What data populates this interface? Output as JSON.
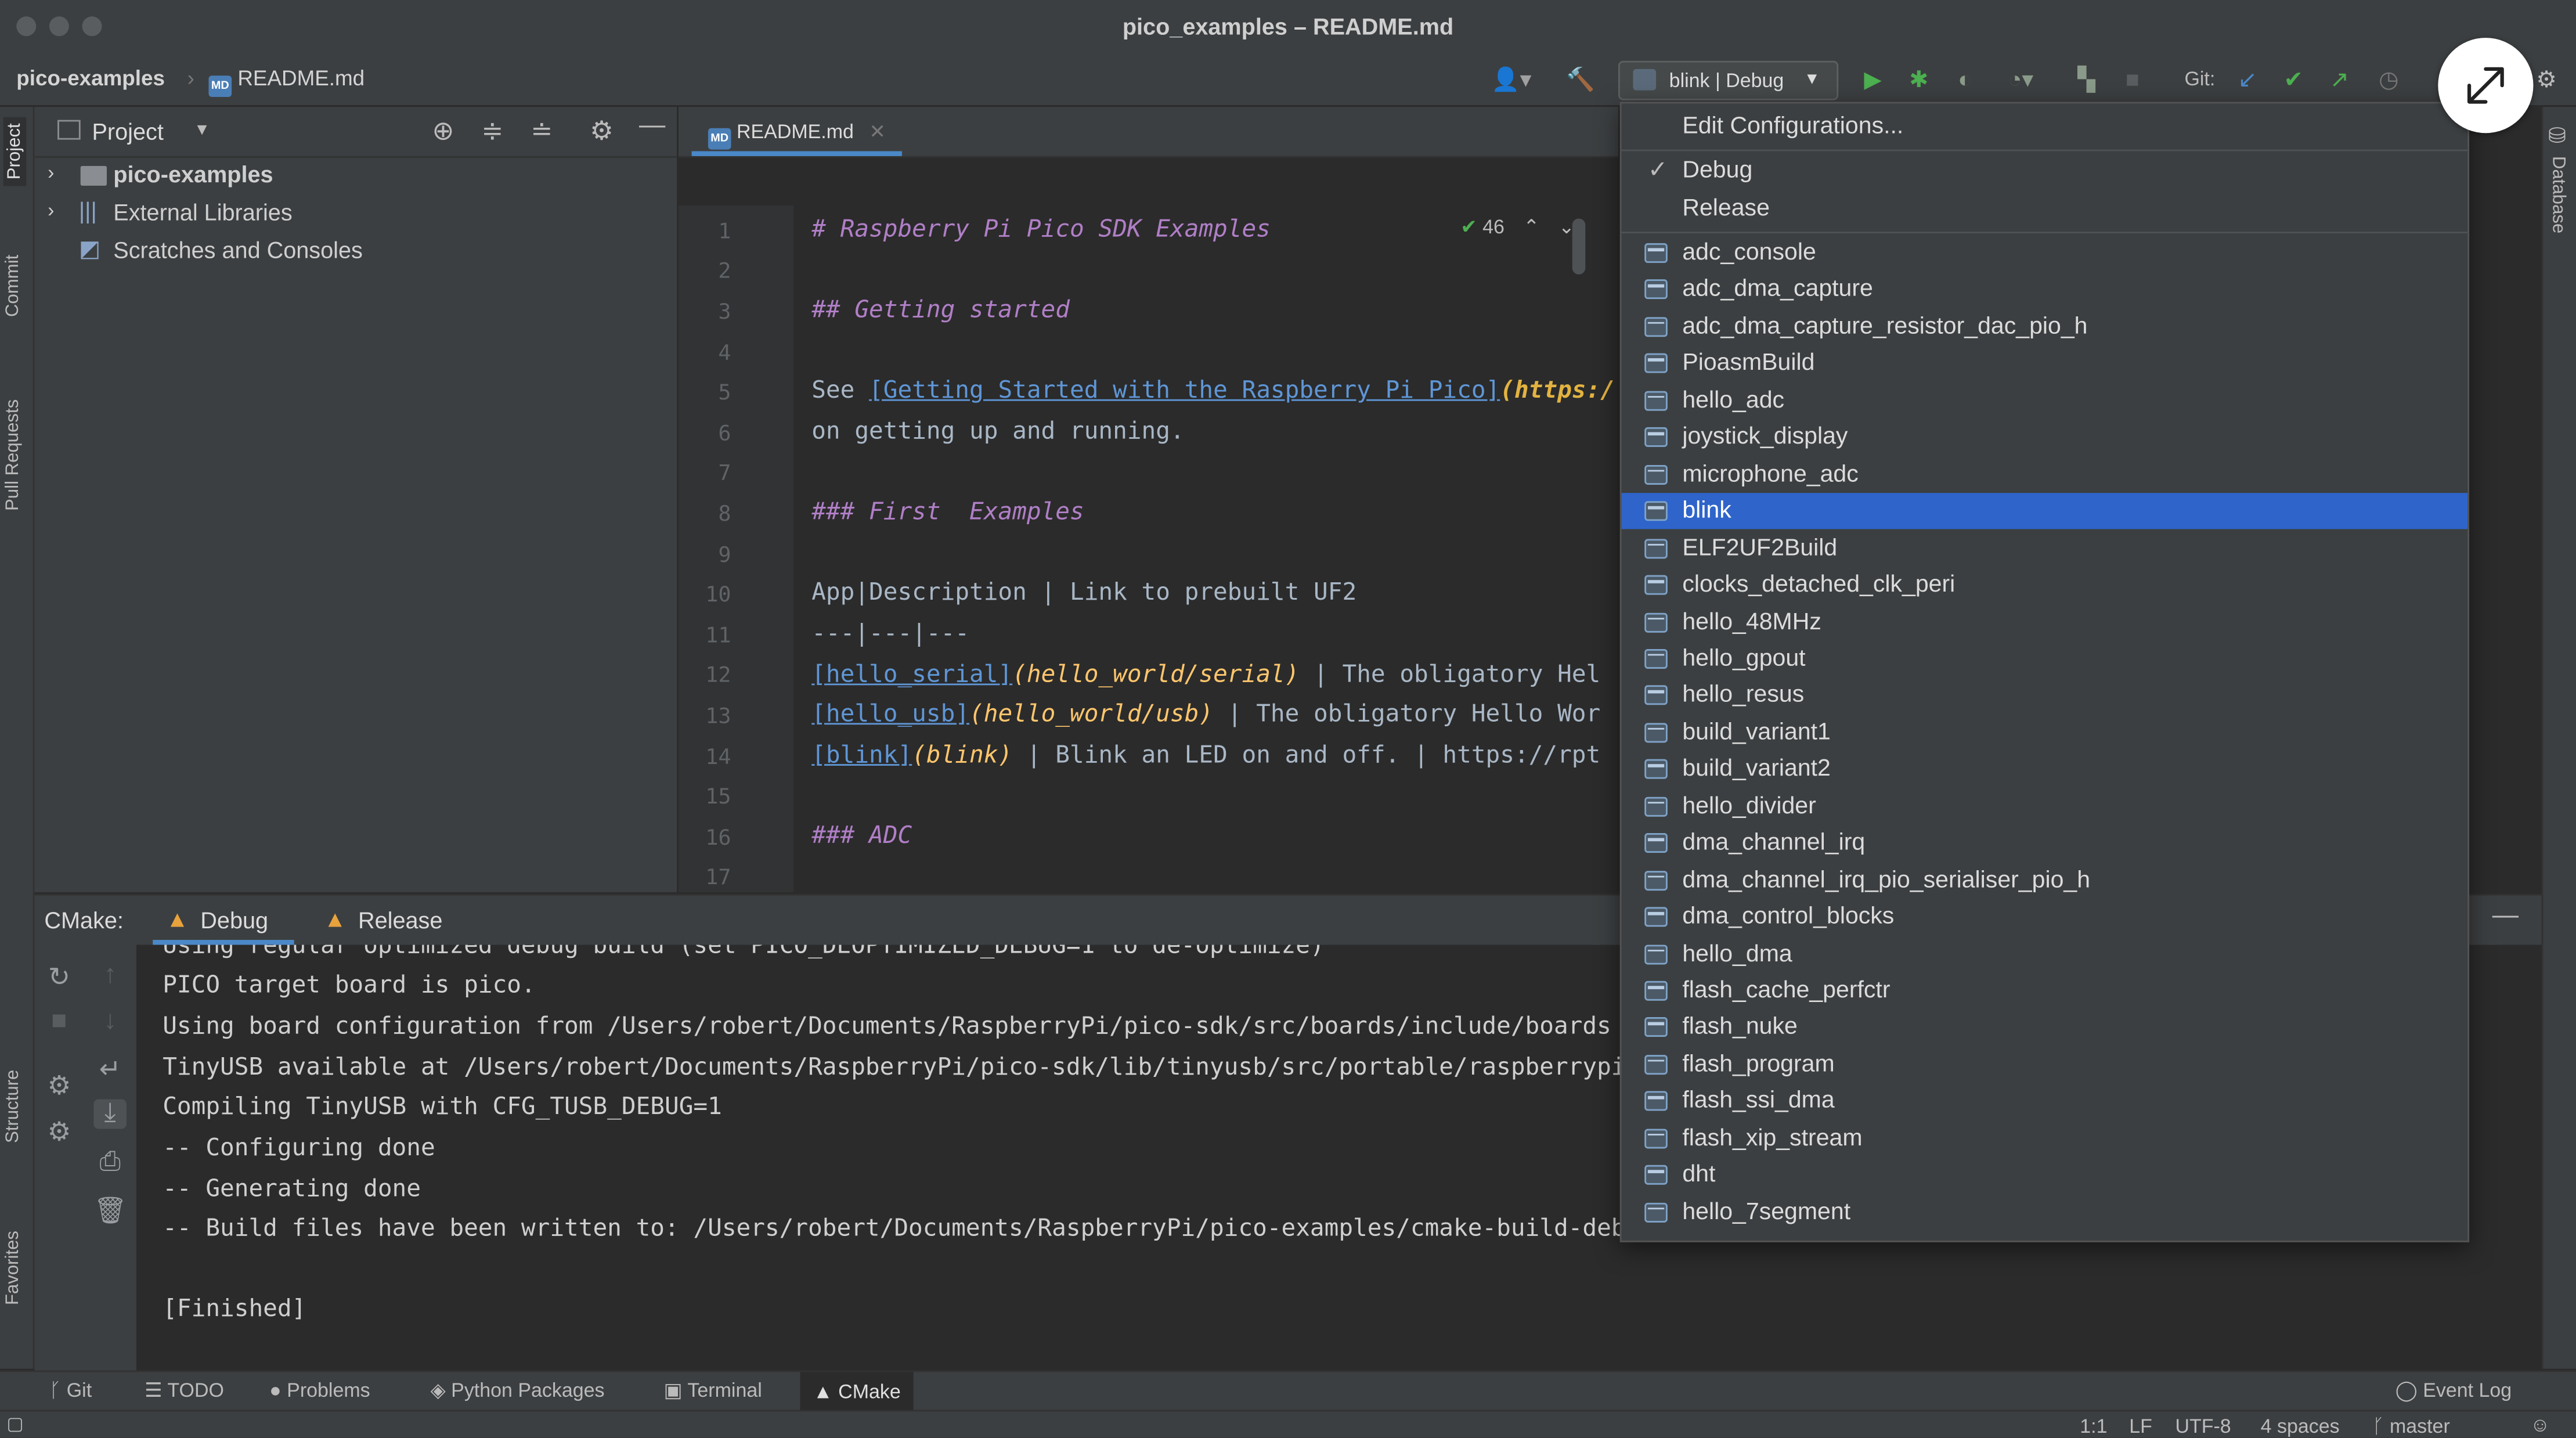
{
  "window": {
    "title": "pico_examples – README.md"
  },
  "navbar": {
    "project": "pico-examples",
    "file": "README.md",
    "md_badge": "MD",
    "run_config": "blink | Debug",
    "git_label": "Git:"
  },
  "project_panel": {
    "title": "Project",
    "tree": [
      {
        "label": "pico-examples",
        "bold": true,
        "expandable": true
      },
      {
        "label": "External Libraries",
        "bold": false,
        "expandable": true
      },
      {
        "label": "Scratches and Consoles",
        "bold": false,
        "expandable": false
      }
    ]
  },
  "left_tabs": {
    "project": "Project",
    "commit": "Commit",
    "pull_requests": "Pull Requests",
    "structure": "Structure",
    "favorites": "Favorites"
  },
  "right_tabs": {
    "database": "Database"
  },
  "editor": {
    "tab": "README.md",
    "inspection_count": "46",
    "lines": [
      "1",
      "2",
      "3",
      "4",
      "5",
      "6",
      "7",
      "8",
      "9",
      "10",
      "11",
      "12",
      "13",
      "14",
      "15",
      "16",
      "17"
    ],
    "code": {
      "l1": "# Raspberry Pi Pico SDK Examples",
      "l3": "## Getting started",
      "l5_pre": "See ",
      "l5_link": "[Getting Started with the Raspberry Pi Pico]",
      "l5_url": "(https:/",
      "l6": "on getting up and running.",
      "l8": "### First  Examples",
      "l10": "App|Description | Link to prebuilt UF2",
      "l11": "---|---|---",
      "l12_link": "[hello_serial]",
      "l12_path": "(hello_world/serial)",
      "l12_rest": " | The obligatory Hel",
      "l13_link": "[hello_usb]",
      "l13_path": "(hello_world/usb)",
      "l13_rest": " | The obligatory Hello Wor",
      "l14_link": "[blink]",
      "l14_path": "(blink)",
      "l14_rest": " | Blink an LED on and off. | https://rpt",
      "l16": "### ADC"
    }
  },
  "cmake": {
    "label": "CMake:",
    "tabs": [
      "Debug",
      "Release"
    ],
    "output": [
      "Using regular optimized debug build (set PICO_DEOPTIMIZED_DEBUG=1 to de-optimize)",
      "PICO target board is pico.",
      "Using board configuration from /Users/robert/Documents/RaspberryPi/pico-sdk/src/boards/include/boards",
      "TinyUSB available at /Users/robert/Documents/RaspberryPi/pico-sdk/lib/tinyusb/src/portable/raspberrypi",
      "Compiling TinyUSB with CFG_TUSB_DEBUG=1",
      "-- Configuring done",
      "-- Generating done",
      "-- Build files have been written to: /Users/robert/Documents/RaspberryPi/pico-examples/cmake-build-deb",
      "",
      "[Finished]"
    ]
  },
  "popup": {
    "edit_configurations": "Edit Configurations...",
    "build_types": [
      {
        "label": "Debug",
        "checked": true
      },
      {
        "label": "Release",
        "checked": false
      }
    ],
    "selected": "blink",
    "targets": [
      "adc_console",
      "adc_dma_capture",
      "adc_dma_capture_resistor_dac_pio_h",
      "PioasmBuild",
      "hello_adc",
      "joystick_display",
      "microphone_adc",
      "blink",
      "ELF2UF2Build",
      "clocks_detached_clk_peri",
      "hello_48MHz",
      "hello_gpout",
      "hello_resus",
      "build_variant1",
      "build_variant2",
      "hello_divider",
      "dma_channel_irq",
      "dma_channel_irq_pio_serialiser_pio_h",
      "dma_control_blocks",
      "hello_dma",
      "flash_cache_perfctr",
      "flash_nuke",
      "flash_program",
      "flash_ssi_dma",
      "flash_xip_stream",
      "dht",
      "hello_7segment"
    ]
  },
  "tool_strip": {
    "items": [
      "Git",
      "TODO",
      "Problems",
      "Python Packages",
      "Terminal",
      "CMake"
    ],
    "event_log": "Event Log"
  },
  "status": {
    "position": "1:1",
    "line_sep": "LF",
    "encoding": "UTF-8",
    "indent": "4 spaces",
    "branch": "master"
  },
  "colors": {
    "accent": "#2f65ca",
    "run_green": "#4caf50",
    "bg": "#2b2b2b",
    "panel": "#3c3f41"
  }
}
